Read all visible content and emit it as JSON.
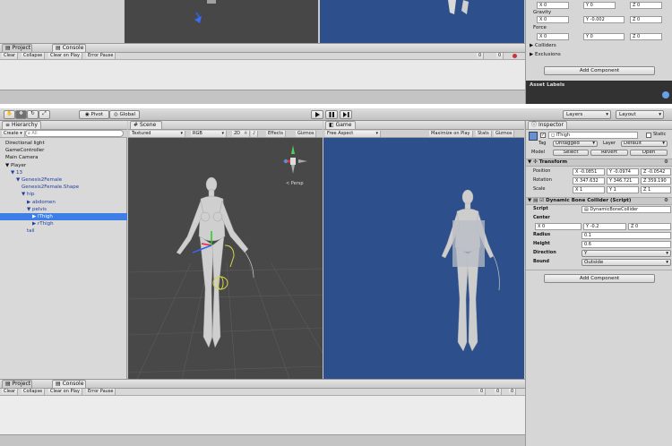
{
  "top": {
    "project_tab": "Project",
    "console_tab": "Console",
    "console_buttons": [
      "Clear",
      "Collapse",
      "Clear on Play",
      "Error Pause"
    ],
    "console_counts": [
      "0",
      "0"
    ],
    "gravity_label": "Gravity",
    "gravity_values": [
      "X 0",
      "Y -0.002",
      "Z 0"
    ],
    "force_label": "Force",
    "force_values": [
      "X 0",
      "Y 0",
      "Z 0"
    ],
    "colliders": "Colliders",
    "exclusions": "Exclusions",
    "add_component": "Add Component",
    "asset_labels": "Asset Labels",
    "top_values": [
      "X 0",
      "Y 0",
      "Z 0"
    ]
  },
  "toolbar": {
    "pivot": "Pivot",
    "global": "Global",
    "layers": "Layers",
    "layout": "Layout"
  },
  "hierarchy": {
    "tab": "Hierarchy",
    "create": "Create",
    "search": "All",
    "items": [
      {
        "label": "Directional light",
        "indent": 0,
        "selected": false,
        "blue": false
      },
      {
        "label": "GameController",
        "indent": 0,
        "selected": false,
        "blue": false
      },
      {
        "label": "Main Camera",
        "indent": 0,
        "selected": false,
        "blue": false
      },
      {
        "label": "▼ Player",
        "indent": 0,
        "selected": false,
        "blue": false
      },
      {
        "label": "▼ 13",
        "indent": 1,
        "selected": false,
        "blue": true
      },
      {
        "label": "▼ Genesis2Female",
        "indent": 2,
        "selected": false,
        "blue": true
      },
      {
        "label": "Genesis2Female.Shape",
        "indent": 3,
        "selected": false,
        "blue": true
      },
      {
        "label": "▼ hip",
        "indent": 3,
        "selected": false,
        "blue": true
      },
      {
        "label": "▶ abdomen",
        "indent": 4,
        "selected": false,
        "blue": true
      },
      {
        "label": "▼ pelvis",
        "indent": 4,
        "selected": false,
        "blue": true
      },
      {
        "label": "▶ lThigh",
        "indent": 5,
        "selected": true,
        "blue": false
      },
      {
        "label": "▶ rThigh",
        "indent": 5,
        "selected": false,
        "blue": true
      },
      {
        "label": "tail",
        "indent": 4,
        "selected": false,
        "blue": true
      }
    ]
  },
  "scene": {
    "tab": "Scene",
    "textured": "Textured",
    "rgb": "RGB",
    "mode2d": "2D",
    "effects": "Effects",
    "gizmos": "Gizmos",
    "persp": "< Persp"
  },
  "game": {
    "tab": "Game",
    "aspect": "Free Aspect",
    "maximize": "Maximize on Play",
    "stats": "Stats",
    "gizmos": "Gizmos"
  },
  "inspector": {
    "tab": "Inspector",
    "object_name": "lThigh",
    "static": "Static",
    "tag_label": "Tag",
    "tag_value": "Untagged",
    "layer_label": "Layer",
    "layer_value": "Default",
    "model_label": "Model",
    "model_buttons": [
      "Select",
      "Revert",
      "Open"
    ],
    "transform_title": "Transform",
    "position_label": "Position",
    "position_values": [
      "X -0.0851",
      "Y -0.0974",
      "Z -0.0542"
    ],
    "rotation_label": "Rotation",
    "rotation_values": [
      "X 347.632",
      "Y 346.721",
      "Z 359.190"
    ],
    "scale_label": "Scale",
    "scale_values": [
      "X 1",
      "Y 1",
      "Z 1"
    ],
    "collider_title": "Dynamic Bone Collider (Script)",
    "script_label": "Script",
    "script_value": "DynamicBoneCollider",
    "center_label": "Center",
    "center_values": [
      "X 0",
      "Y -0.2",
      "Z 0"
    ],
    "radius_label": "Radius",
    "radius_value": "0.1",
    "height_label": "Height",
    "height_value": "0.6",
    "direction_label": "Direction",
    "direction_value": "Y",
    "bound_label": "Bound",
    "bound_value": "Outside",
    "add_component": "Add Component"
  },
  "bottom": {
    "project_tab": "Project",
    "console_tab": "Console",
    "console_buttons": [
      "Clear",
      "Collapse",
      "Clear on Play",
      "Error Pause"
    ],
    "console_counts": [
      "0",
      "0",
      "0"
    ]
  },
  "colors": {
    "scene_bg": "#484848",
    "game_bg": "#2d4f8c",
    "selection": "#3d7fe6",
    "editor_bg": "#c8c8c8"
  }
}
